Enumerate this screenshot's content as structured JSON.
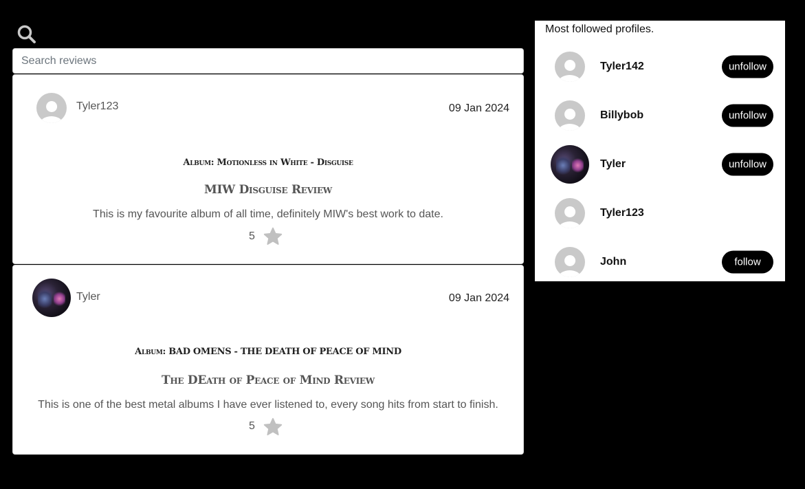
{
  "search": {
    "icon": "search-icon",
    "placeholder": "Search reviews",
    "value": ""
  },
  "reviews": [
    {
      "author": "Tyler123",
      "avatar": "default-avatar",
      "date": "09 Jan 2024",
      "album": "Album: Motionless in White - Disguise",
      "title": "MIW Disguise Review",
      "body": "This is my favourite album of all time, definitely MIW's best work to date.",
      "rating": "5",
      "rating_icon": "star-icon"
    },
    {
      "author": "Tyler",
      "avatar": "album-art-avatar",
      "date": "09 Jan 2024",
      "album": "Album: BAD OMENS - THE DEATH OF PEACE OF MIND",
      "title": "The DEath of Peace of Mind Review",
      "body": "This is one of the best metal albums I have ever listened to, every song hits from start to finish.",
      "rating": "5",
      "rating_icon": "star-icon"
    }
  ],
  "profiles_panel": {
    "title": "Most followed profiles.",
    "profiles": [
      {
        "name": "Tyler142",
        "avatar": "default-avatar",
        "button": "unfollow"
      },
      {
        "name": "Billybob",
        "avatar": "default-avatar",
        "button": "unfollow"
      },
      {
        "name": "Tyler",
        "avatar": "album-art-avatar",
        "button": "unfollow"
      },
      {
        "name": "Tyler123",
        "avatar": "default-avatar",
        "button": ""
      },
      {
        "name": "John",
        "avatar": "default-avatar",
        "button": "follow"
      }
    ]
  },
  "colors": {
    "background": "#000000",
    "card": "#ffffff",
    "button": "#000000",
    "star": "#c0c0c0",
    "avatar_default": "#c9c9c9"
  }
}
